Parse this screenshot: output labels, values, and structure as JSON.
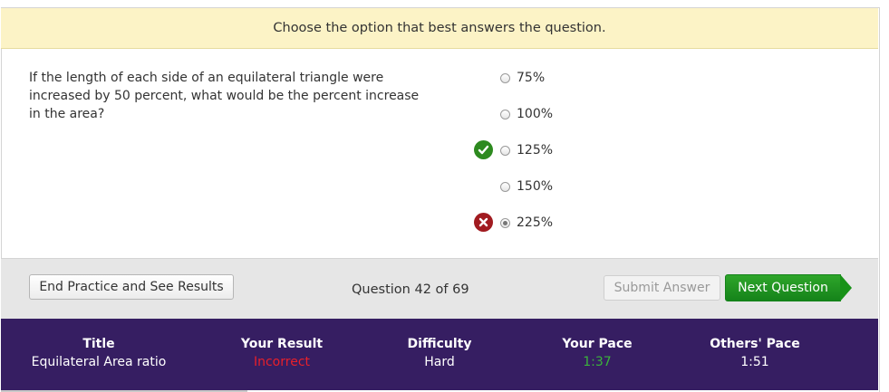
{
  "instruction": "Choose the option that best answers the question.",
  "question": "If the length of each side of an equilateral triangle were increased by 50 percent, what would be the percent increase in the area?",
  "options": [
    {
      "label": "75%",
      "selected": false,
      "status": "none"
    },
    {
      "label": "100%",
      "selected": false,
      "status": "none"
    },
    {
      "label": "125%",
      "selected": false,
      "status": "correct"
    },
    {
      "label": "150%",
      "selected": false,
      "status": "none"
    },
    {
      "label": "225%",
      "selected": true,
      "status": "incorrect"
    }
  ],
  "toolbar": {
    "end_label": "End Practice and See Results",
    "question_count": "Question 42 of 69",
    "submit_label": "Submit Answer",
    "next_label": "Next Question"
  },
  "stats": {
    "title_label": "Title",
    "title_value": "Equilateral Area ratio",
    "result_label": "Your Result",
    "result_value": "Incorrect",
    "difficulty_label": "Difficulty",
    "difficulty_value": "Hard",
    "pace_label": "Your Pace",
    "pace_value": "1:37",
    "others_label": "Others' Pace",
    "others_value": "1:51"
  },
  "colors": {
    "instruction_bg": "#fcf3c6",
    "correct": "#2d8a1f",
    "incorrect": "#a11b20",
    "stats_bg": "#361e62",
    "result_incorrect": "#e8202a",
    "pace_good": "#3bb33b",
    "next_button": "#15831a"
  }
}
